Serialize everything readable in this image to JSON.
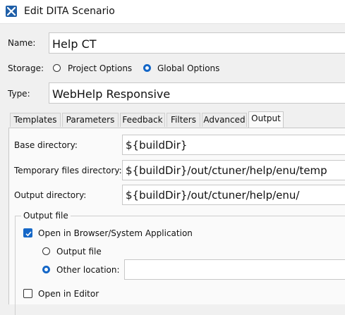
{
  "window": {
    "title": "Edit DITA Scenario",
    "icon": "oxygen-app-icon"
  },
  "name": {
    "label": "Name:",
    "value": "Help CT"
  },
  "storage": {
    "label": "Storage:",
    "options": [
      {
        "label": "Project Options",
        "selected": false
      },
      {
        "label": "Global Options",
        "selected": true
      }
    ]
  },
  "type": {
    "label": "Type:",
    "value": "WebHelp Responsive"
  },
  "tabs": [
    {
      "label": "Templates",
      "active": false
    },
    {
      "label": "Parameters",
      "active": false
    },
    {
      "label": "Feedback",
      "active": false
    },
    {
      "label": "Filters",
      "active": false
    },
    {
      "label": "Advanced",
      "active": false
    },
    {
      "label": "Output",
      "active": true
    }
  ],
  "output": {
    "base_dir": {
      "label": "Base directory:",
      "value": "${buildDir}"
    },
    "temp_dir": {
      "label": "Temporary files directory:",
      "value": "${buildDir}/out/ctuner/help/enu/temp"
    },
    "output_dir": {
      "label": "Output directory:",
      "value": "${buildDir}/out/ctuner/help/enu/"
    },
    "output_file": {
      "group_title": "Output file",
      "open_browser": {
        "label": "Open in Browser/System Application",
        "checked": true
      },
      "output_file_option": {
        "label": "Output file",
        "selected": false
      },
      "other_location": {
        "label": "Other location:",
        "selected": true,
        "value": ""
      },
      "open_editor": {
        "label": "Open in Editor",
        "checked": false
      }
    }
  },
  "colors": {
    "accent": "#1567c7",
    "app_icon": "#1f5fa8"
  }
}
